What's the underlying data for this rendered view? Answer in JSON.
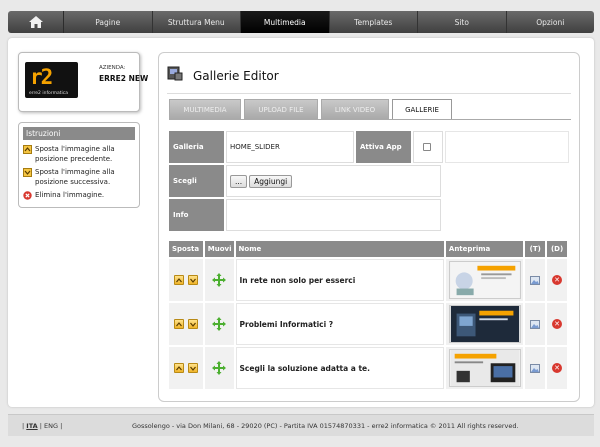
{
  "nav": {
    "items": [
      {
        "label": "Pagine"
      },
      {
        "label": "Struttura Menu"
      },
      {
        "label": "Multimedia"
      },
      {
        "label": "Templates"
      },
      {
        "label": "Sito"
      },
      {
        "label": "Opzioni"
      }
    ],
    "active": "Multimedia"
  },
  "company": {
    "logo_text": "r2",
    "logo_sub": "erre2 informatica",
    "label": "AZIENDA:",
    "name": "ERRE2 NEW"
  },
  "instructions": {
    "title": "Istruzioni",
    "items": [
      {
        "icon": "arrow-up-icon",
        "text": "Sposta l'immagine alla posizione precedente."
      },
      {
        "icon": "arrow-down-icon",
        "text": "Sposta l'immagine alla posizione successiva."
      },
      {
        "icon": "delete-icon",
        "text": "Elimina l'immagine."
      }
    ]
  },
  "editor": {
    "title": "Gallerie Editor",
    "tabs": [
      {
        "label": "MULTIMEDIA"
      },
      {
        "label": "UPLOAD FILE"
      },
      {
        "label": "LINK VIDEO"
      },
      {
        "label": "GALLERIE"
      }
    ],
    "active_tab": "GALLERIE",
    "form": {
      "galleria_label": "Galleria",
      "galleria_value": "HOME_SLIDER",
      "attiva_label": "Attiva App",
      "scegli_label": "Scegli",
      "browse_label": "...",
      "add_label": "Aggiungi",
      "info_label": "Info"
    },
    "table": {
      "headers": {
        "sposta": "Sposta",
        "muovi": "Muovi",
        "nome": "Nome",
        "anteprima": "Anteprima",
        "t": "(T)",
        "d": "(D)"
      },
      "rows": [
        {
          "name": "In rete non solo per esserci"
        },
        {
          "name": "Problemi Informatici ?"
        },
        {
          "name": "Scegli la soluzione adatta a te."
        }
      ]
    }
  },
  "footer": {
    "lang_current": "ITA",
    "lang_other": "ENG",
    "sep": "|",
    "copyright": "Gossolengo - via Don Milani, 68 - 29020 (PC) - Partita IVA 01574870331 - erre2 informatica © 2011 All rights reserved."
  },
  "colors": {
    "header_gray": "#8a8a8a",
    "accent_orange": "#f5a200",
    "delete_red": "#d8382f",
    "move_green": "#4caf30"
  }
}
